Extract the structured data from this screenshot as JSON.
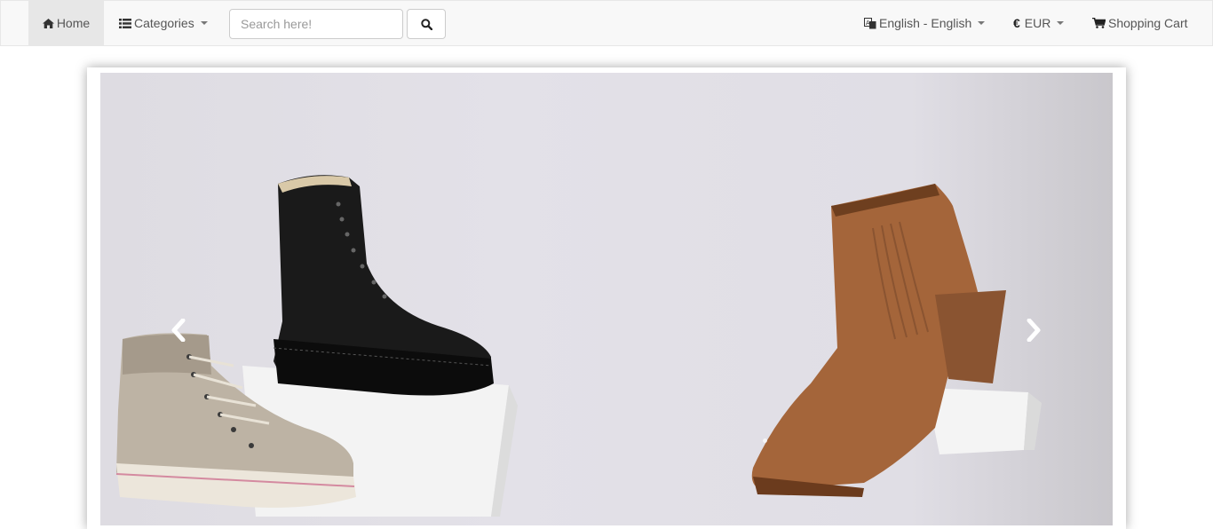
{
  "navbar": {
    "home_label": "Home",
    "categories_label": "Categories",
    "search": {
      "placeholder": "Search here!",
      "value": ""
    },
    "language_label": "English - English",
    "currency_label": "EUR",
    "currency_symbol": "€",
    "cart_label": "Shopping Cart"
  },
  "carousel": {
    "slide_image": "winter-boots-banner",
    "prev_icon": "chevron-left-icon",
    "next_icon": "chevron-right-icon"
  },
  "colors": {
    "navbar_bg": "#f8f8f8",
    "active_bg": "#e7e7e7",
    "text": "#555555"
  }
}
